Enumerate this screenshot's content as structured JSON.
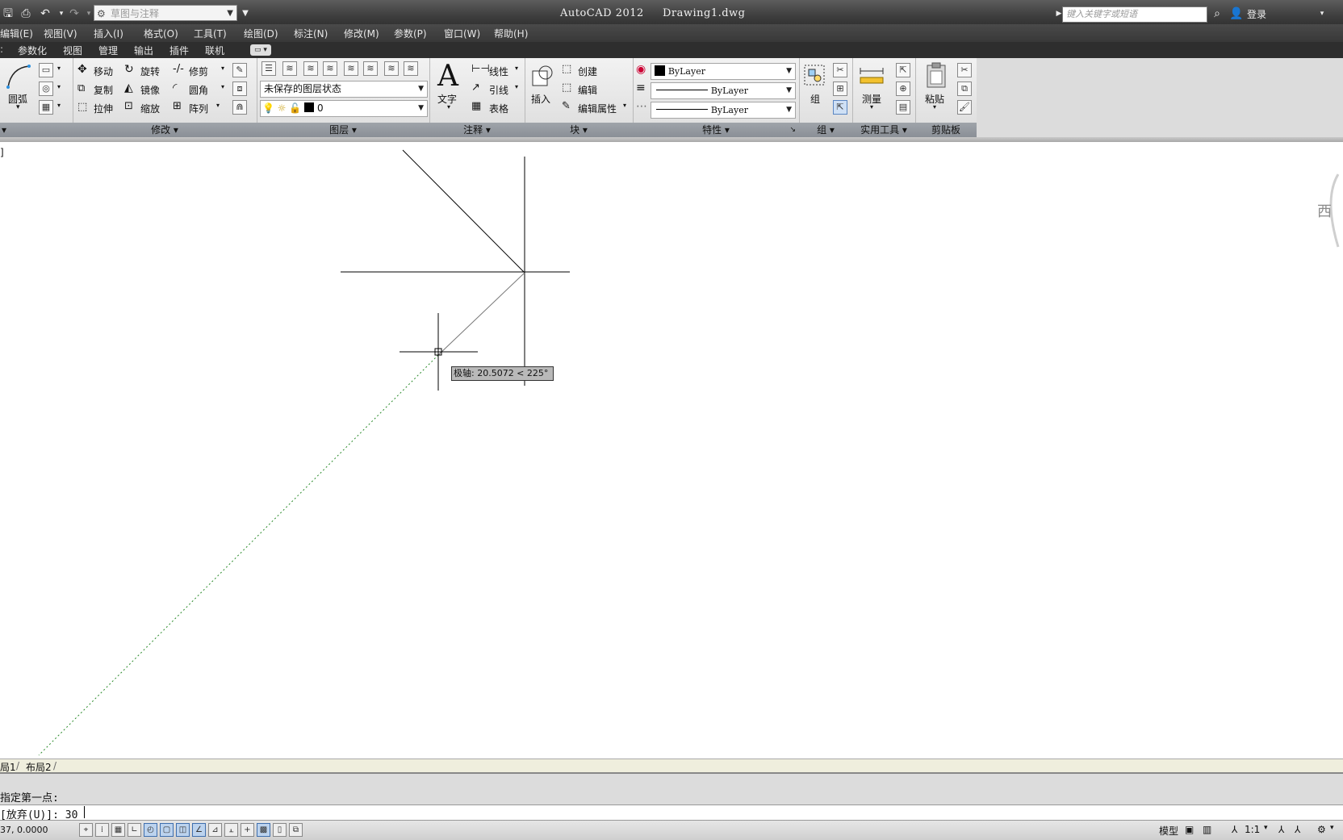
{
  "titlebar": {
    "workspace": "草图与注释",
    "app_title": "AutoCAD 2012     Drawing1.dwg",
    "search_placeholder": "键入关键字或短语",
    "login": "登录"
  },
  "menubar": [
    "编辑(E)",
    "视图(V)",
    "插入(I)",
    "格式(O)",
    "工具(T)",
    "绘图(D)",
    "标注(N)",
    "修改(M)",
    "参数(P)",
    "窗口(W)",
    "帮助(H)"
  ],
  "ribbon_tabs": [
    "参数化",
    "视图",
    "管理",
    "输出",
    "插件",
    "联机"
  ],
  "ribbon": {
    "draw": {
      "arc_label": "圆弧"
    },
    "modify": {
      "title": "修改",
      "move": "移动",
      "rotate": "旋转",
      "trim": "修剪",
      "copy": "复制",
      "mirror": "镜像",
      "fillet": "圆角",
      "stretch": "拉伸",
      "scale": "缩放",
      "array": "阵列"
    },
    "layers": {
      "title": "图层",
      "layer_state": "未保存的图层状态",
      "current_layer": "0"
    },
    "annotation": {
      "title": "注释",
      "text": "文字",
      "linear": "线性",
      "leader": "引线",
      "table": "表格"
    },
    "block": {
      "title": "块",
      "insert": "插入",
      "create": "创建",
      "edit": "编辑",
      "edit_attributes": "编辑属性"
    },
    "properties": {
      "title": "特性",
      "color": "ByLayer",
      "linetype": "ByLayer",
      "lineweight": "ByLayer"
    },
    "groups": {
      "title": "组",
      "group": "组"
    },
    "utilities": {
      "title": "实用工具",
      "measure": "测量"
    },
    "clipboard": {
      "title": "剪贴板",
      "paste": "粘贴"
    }
  },
  "drawing": {
    "view_label": "]",
    "tooltip": "极轴: 20.5072 < 225°",
    "viewcube_west": "西"
  },
  "layout_tabs": [
    "局1",
    "布局2"
  ],
  "command": {
    "history": "指定第一点:",
    "prompt": "[放弃(U)]: 30"
  },
  "statusbar": {
    "coords": "37, 0.0000",
    "model": "模型",
    "annotation_scale": "1:1"
  }
}
